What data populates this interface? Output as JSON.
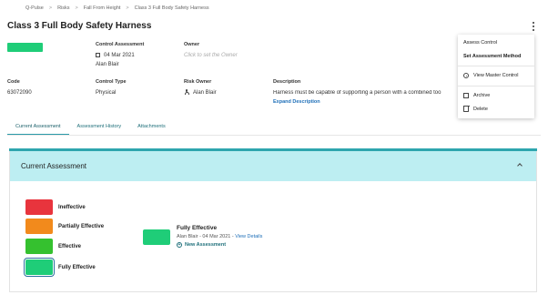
{
  "breadcrumb": [
    "Q-Pulse",
    "Risks",
    "Fall From Height",
    "Class 3 Full Body Safety Harness"
  ],
  "breadcrumb_separator": ">",
  "page_title": "Class 3 Full Body Safety Harness",
  "status_color": "#1fcd78",
  "fields": {
    "control_assessment": {
      "label": "Control Assessment",
      "date": "04 Mar 2021",
      "by": "Alan Blair"
    },
    "owner": {
      "label": "Owner",
      "placeholder": "Click to set the Owner"
    },
    "code": {
      "label": "Code",
      "value": "63072090"
    },
    "control_type": {
      "label": "Control Type",
      "value": "Physical"
    },
    "risk_owner": {
      "label": "Risk Owner",
      "value": "Alan Blair"
    },
    "description": {
      "label": "Description",
      "value": "Harness must be capable of supporting a person with a combined too",
      "expand_label": "Expand Description"
    }
  },
  "tabs": [
    {
      "label": "Current Assessment",
      "active": true
    },
    {
      "label": "Assessment History",
      "active": false
    },
    {
      "label": "Attachments",
      "active": false
    }
  ],
  "current_assessment": {
    "title": "Current Assessment",
    "header_color": "#bdeef2",
    "levels": [
      {
        "label": "Ineffective",
        "color": "#e8343d",
        "selected": false
      },
      {
        "label": "Partially Effective",
        "color": "#f28a1c",
        "selected": false
      },
      {
        "label": "Effective",
        "color": "#35c12f",
        "selected": false
      },
      {
        "label": "Fully Effective",
        "color": "#1fcd78",
        "selected": true
      }
    ],
    "result": {
      "title": "Fully Effective",
      "meta_prefix": "Alan Blair - 04 Mar 2021 -",
      "view_details": "View Details",
      "new_assessment": "New Assessment",
      "color": "#1fcd78"
    }
  },
  "actions_menu": {
    "items": [
      "Assess Control",
      "Set Assessment Method",
      "View Master Control",
      "Archive",
      "Delete"
    ],
    "icons": [
      "",
      "",
      "eye-icon",
      "archive-icon",
      "trash-icon"
    ]
  }
}
